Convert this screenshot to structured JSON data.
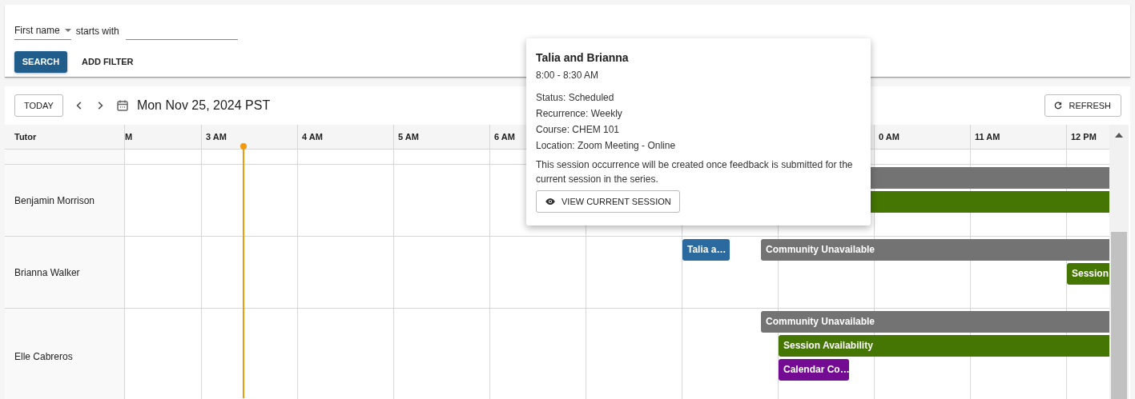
{
  "filter": {
    "field": "First name",
    "operator": "starts with"
  },
  "filter_buttons": {
    "search": "SEARCH",
    "add_filter": "ADD FILTER"
  },
  "toolbar": {
    "today": "TODAY",
    "date": "Mon Nov 25, 2024 PST",
    "refresh": "REFRESH"
  },
  "schedule": {
    "tutor_header": "Tutor",
    "hours": [
      "M",
      "3 AM",
      "4 AM",
      "5 AM",
      "6 AM",
      "0 AM",
      "11 AM",
      "12 PM"
    ],
    "rows": [
      {
        "tutor": "Benjamin Morrison",
        "events": [
          {
            "kind": "unavailable"
          },
          {
            "kind": "availability"
          }
        ]
      },
      {
        "tutor": "Brianna Walker",
        "events": [
          {
            "kind": "session",
            "label": "Talia a…"
          },
          {
            "kind": "unavailable",
            "label": "Community Unavailable"
          },
          {
            "kind": "availability",
            "label": "Session"
          }
        ]
      },
      {
        "tutor": "Elle Cabreros",
        "events": [
          {
            "kind": "unavailable",
            "label": "Community Unavailable"
          },
          {
            "kind": "availability",
            "label": "Session Availability"
          },
          {
            "kind": "calendar",
            "label": "Calendar Co…"
          }
        ]
      }
    ]
  },
  "popover": {
    "title": "Talia and Brianna",
    "time": "8:00 - 8:30 AM",
    "details": [
      "Status: Scheduled",
      "Recurrence: Weekly",
      "Course: CHEM 101",
      "Location: Zoom Meeting - Online"
    ],
    "note": "This session occurrence will be created once feedback is submitted for the current session in the series.",
    "button": "VIEW CURRENT SESSION"
  }
}
